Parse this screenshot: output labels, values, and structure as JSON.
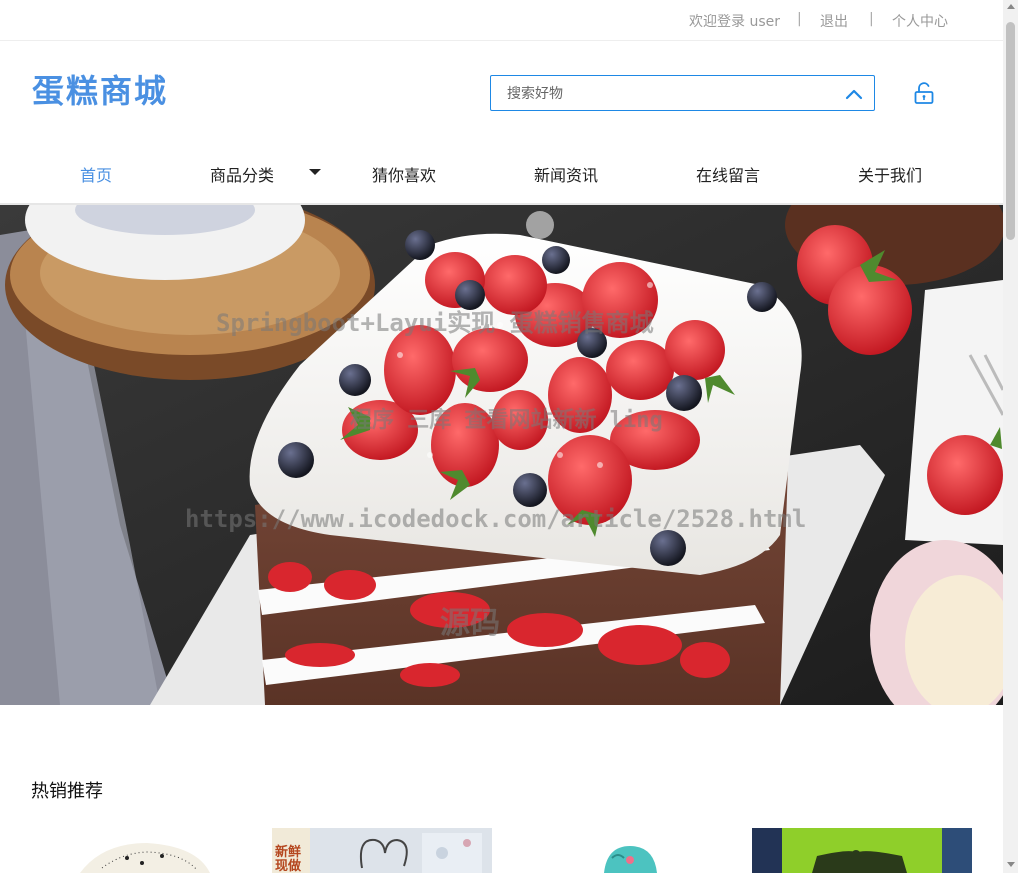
{
  "topbar": {
    "welcome": "欢迎登录 user",
    "sep1": "|",
    "logout": "退出",
    "sep2": "|",
    "user_center": "个人中心"
  },
  "header": {
    "logo": "蛋糕商城",
    "search_placeholder": "搜索好物",
    "accent_color": "#4a90e2"
  },
  "nav": {
    "items": [
      {
        "label": "首页",
        "active": true
      },
      {
        "label": "商品分类",
        "has_dropdown": true
      },
      {
        "label": "猜你喜欢"
      },
      {
        "label": "新闻资讯"
      },
      {
        "label": "在线留言"
      },
      {
        "label": "关于我们"
      }
    ]
  },
  "banner": {
    "watermark_line1": "Springboot+Layui实现    蛋糕销售商城",
    "watermark_line2": "程序 三库 查看网站新新 ling",
    "watermark_line3": "https://www.icodedock.com/article/2528.html",
    "watermark_line4": "源码",
    "slide_labels": {
      "box_tag": "新鲜现做"
    }
  },
  "hot": {
    "title": "热销推荐"
  },
  "icons": [
    "chevron-up-icon",
    "unlock-icon",
    "caret-down-icon"
  ]
}
